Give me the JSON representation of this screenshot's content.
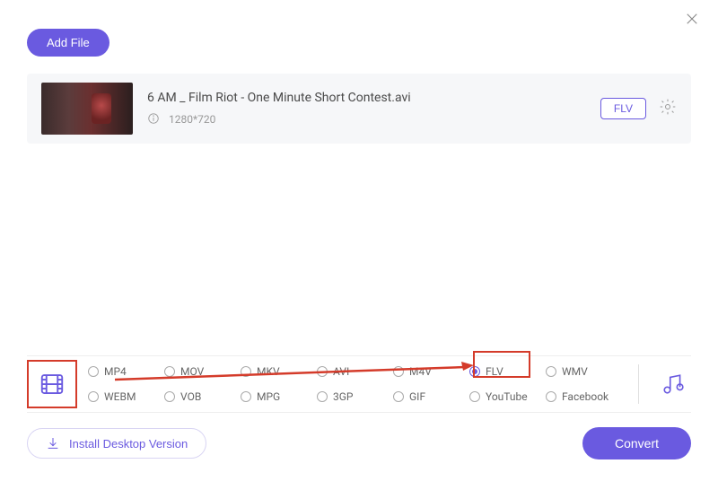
{
  "header": {
    "add_file_label": "Add File"
  },
  "file": {
    "title": "6 AM _ Film Riot - One Minute Short Contest.avi",
    "resolution": "1280*720",
    "output_format": "FLV"
  },
  "formats": {
    "row1": [
      "MP4",
      "MOV",
      "MKV",
      "AVI",
      "M4V",
      "FLV",
      "WMV"
    ],
    "row2": [
      "WEBM",
      "VOB",
      "MPG",
      "3GP",
      "GIF",
      "YouTube",
      "Facebook"
    ],
    "selected": "FLV"
  },
  "footer": {
    "install_label": "Install Desktop Version",
    "convert_label": "Convert"
  }
}
